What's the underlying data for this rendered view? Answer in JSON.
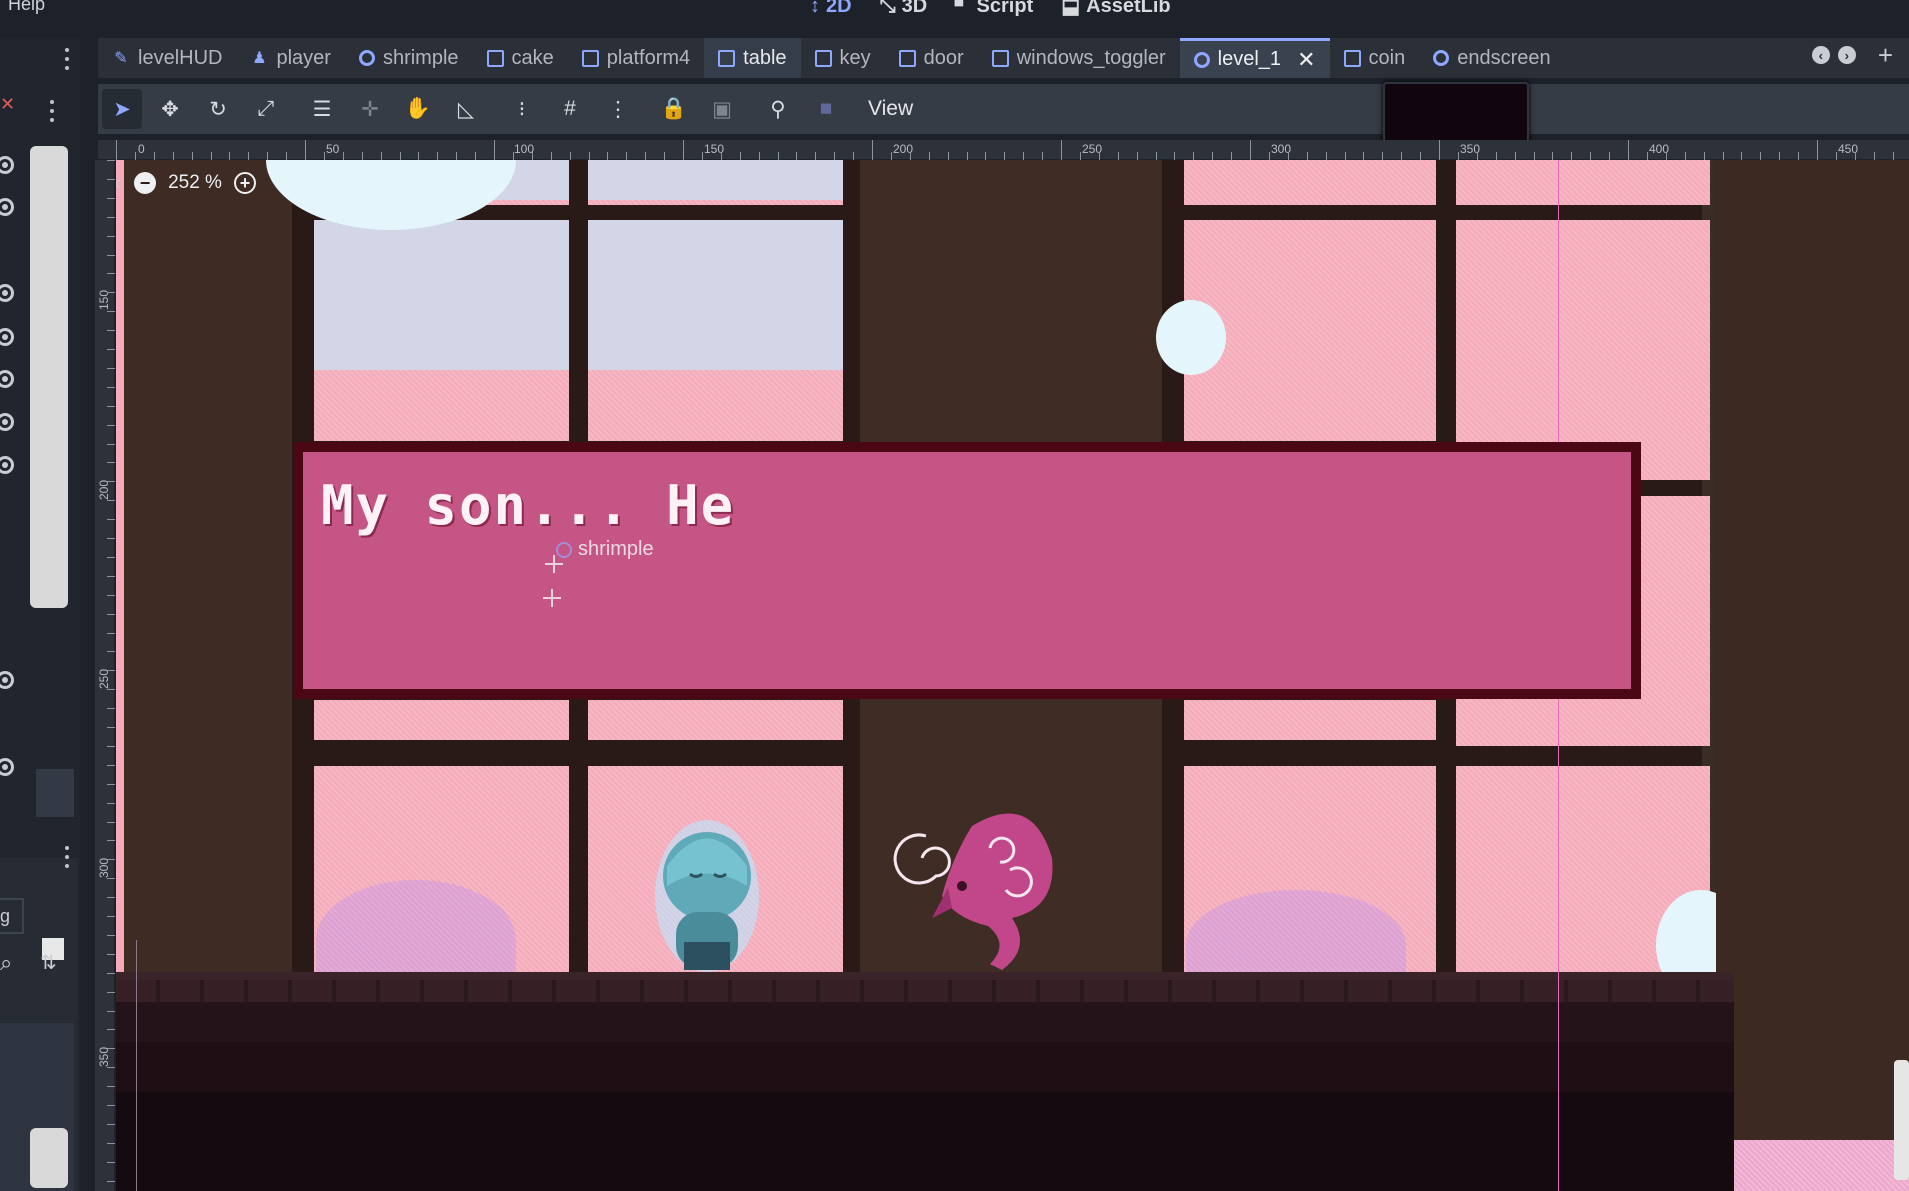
{
  "menu": {
    "help": "Help"
  },
  "workspaces": [
    {
      "label": "2D",
      "icon": "2d-icon",
      "active": true
    },
    {
      "label": "3D",
      "icon": "3d-icon"
    },
    {
      "label": "Script",
      "icon": "script-icon"
    },
    {
      "label": "AssetLib",
      "icon": "assetlib-icon"
    }
  ],
  "tabs": [
    {
      "label": "levelHUD",
      "icon": "control-icon"
    },
    {
      "label": "player",
      "icon": "character-icon"
    },
    {
      "label": "shrimple",
      "icon": "node-icon"
    },
    {
      "label": "cake",
      "icon": "sprite-icon"
    },
    {
      "label": "platform4",
      "icon": "body-icon"
    },
    {
      "label": "table",
      "icon": "body-icon",
      "selected": true
    },
    {
      "label": "key",
      "icon": "sprite-icon"
    },
    {
      "label": "door",
      "icon": "body-icon"
    },
    {
      "label": "windows_toggler",
      "icon": "sprite-icon"
    },
    {
      "label": "level_1",
      "icon": "node-icon",
      "current": true
    },
    {
      "label": "coin",
      "icon": "sprite-icon"
    },
    {
      "label": "endscreen",
      "icon": "node-icon"
    }
  ],
  "toolbar": {
    "view": "View"
  },
  "canvas": {
    "zoom": "252 %",
    "ruler_top": [
      "0",
      "50",
      "100",
      "150",
      "200",
      "250",
      "300",
      "350",
      "400",
      "450"
    ],
    "ruler_left": [
      "150",
      "200",
      "250",
      "300",
      "350"
    ],
    "node_label": "shrimple"
  },
  "dialog": {
    "text": "My son... He"
  },
  "colors": {
    "accent": "#8ea7ff",
    "dialog_fill": "#c45585",
    "dialog_border": "#4b0713",
    "swatch": "#17475a"
  }
}
